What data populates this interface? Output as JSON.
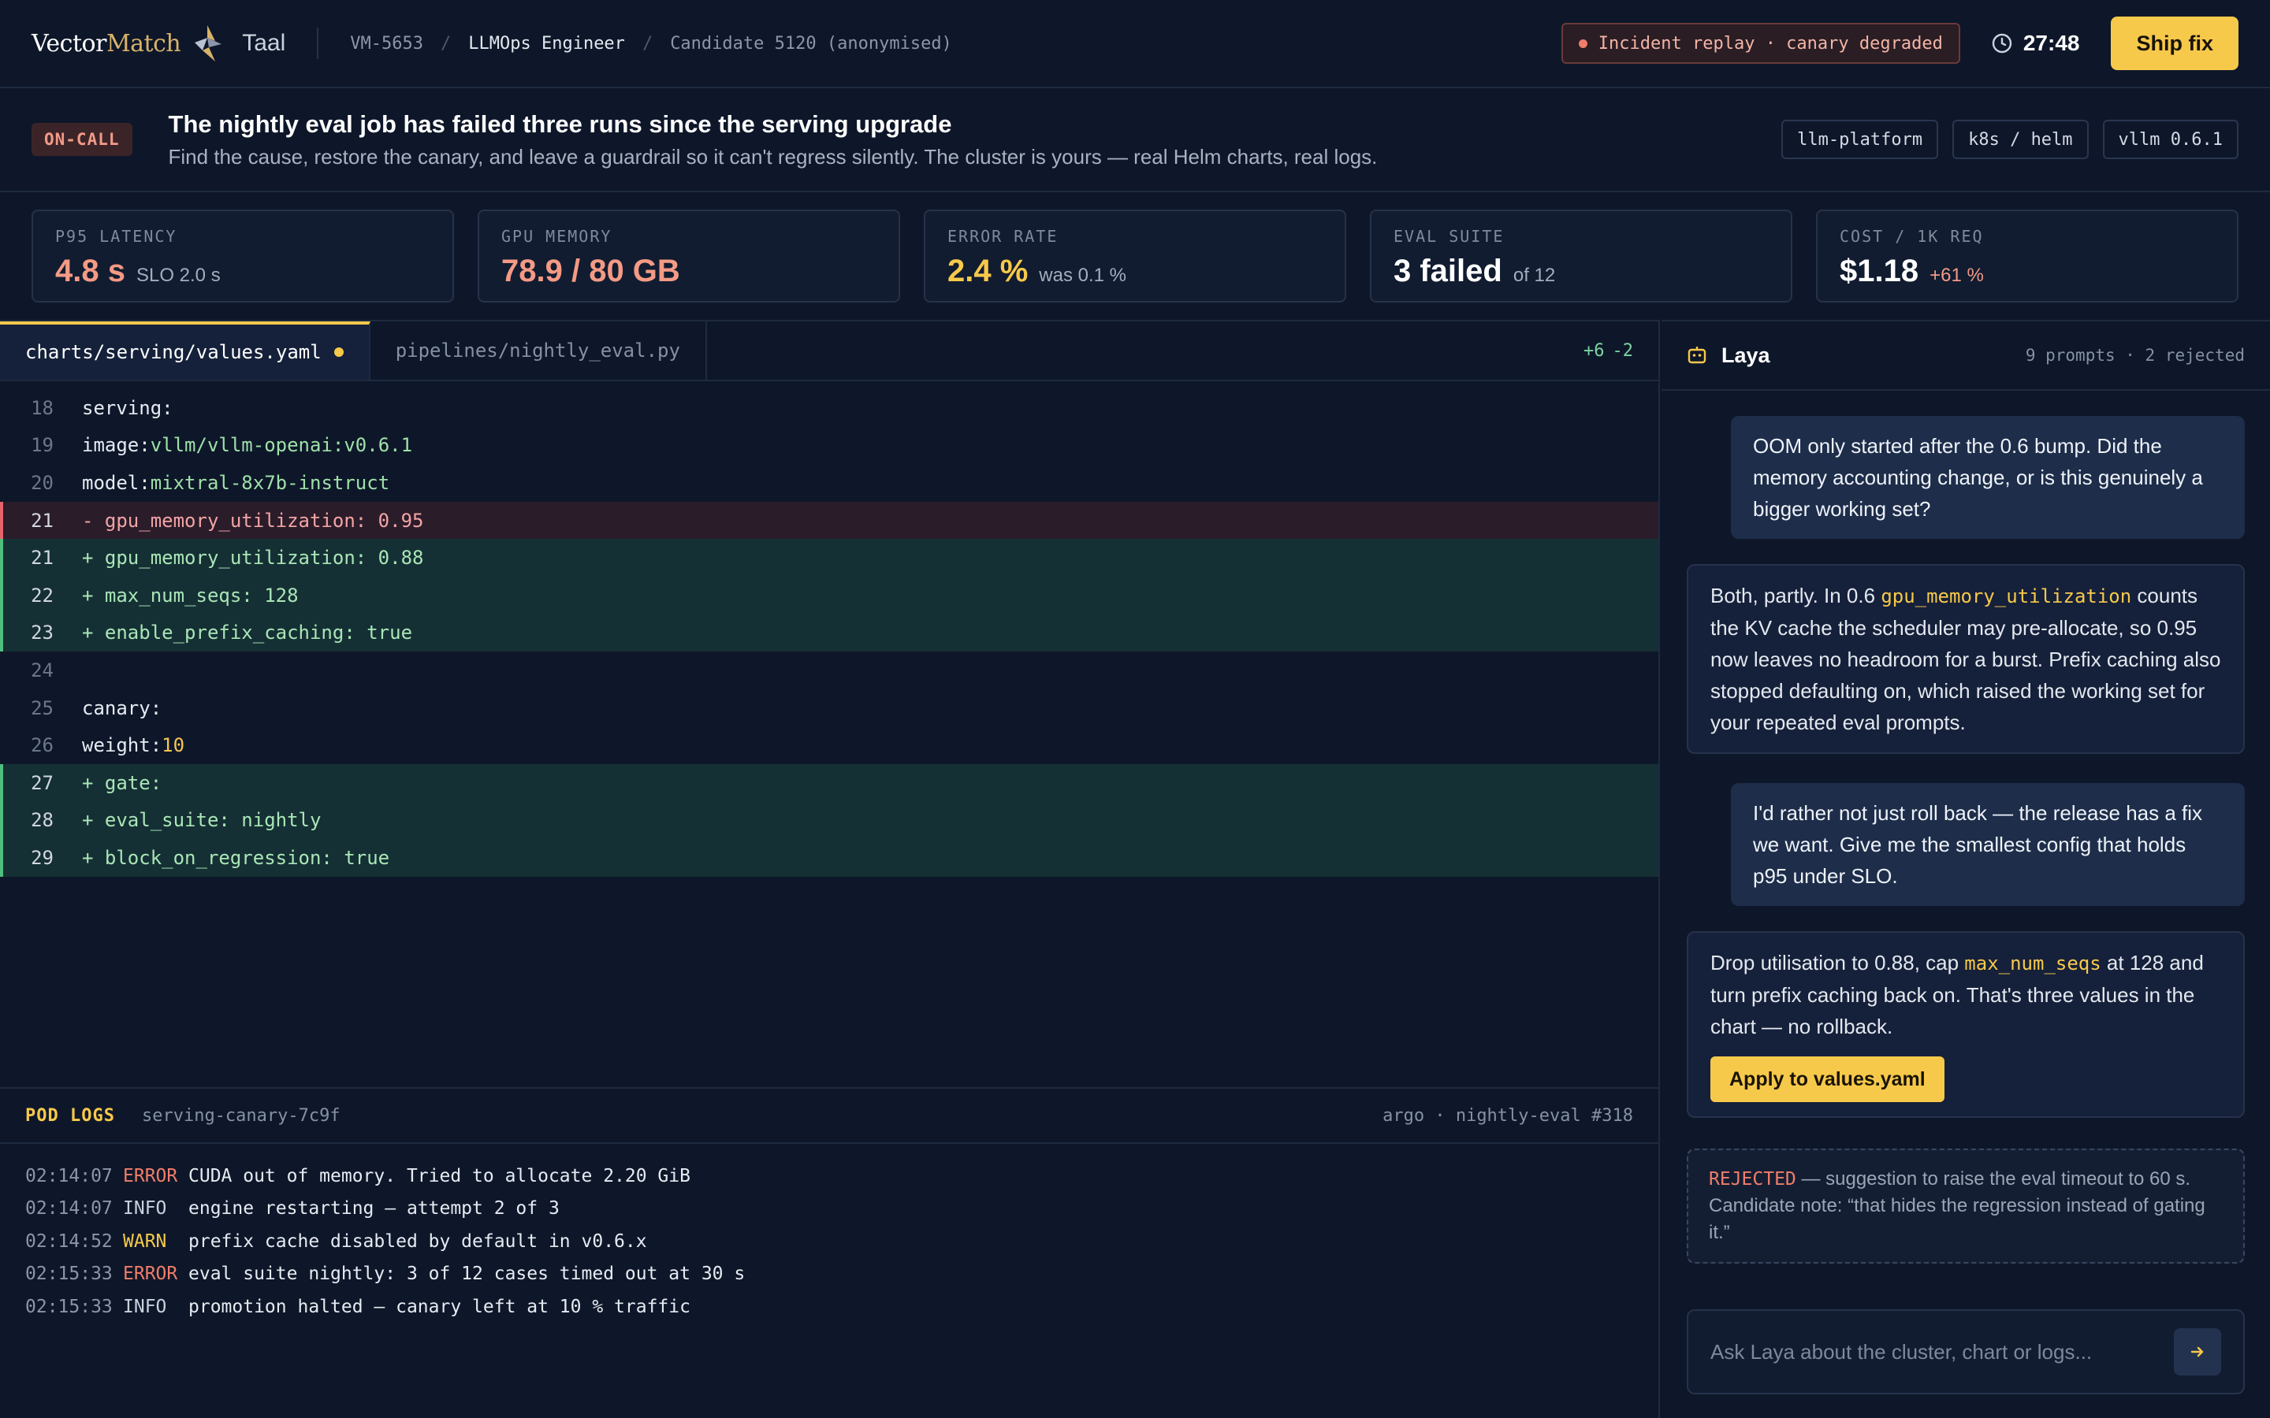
{
  "header": {
    "brand_vector": "Vector",
    "brand_match": "Match",
    "brand_sub": "Taal",
    "breadcrumb": [
      "VM-5653",
      "LLMOps Engineer",
      "Candidate 5120 (anonymised)"
    ],
    "incident": "Incident replay · canary degraded",
    "timer": "27:48",
    "ship_label": "Ship fix"
  },
  "brief": {
    "badge": "ON-CALL",
    "title": "The nightly eval job has failed three runs since the serving upgrade",
    "subtitle": "Find the cause, restore the canary, and leave a guardrail so it can't regress silently. The cluster is yours — real Helm charts, real logs.",
    "tags": [
      "llm-platform",
      "k8s / helm",
      "vllm 0.6.1"
    ]
  },
  "metrics": [
    {
      "label": "P95 LATENCY",
      "value": "4.8 s",
      "note": "SLO 2.0 s",
      "color": "#f49a85"
    },
    {
      "label": "GPU MEMORY",
      "value": "78.9 / 80 GB",
      "note": "",
      "color": "#f49a85"
    },
    {
      "label": "ERROR RATE",
      "value": "2.4 %",
      "note": "was 0.1 %",
      "color": "#f7c94b"
    },
    {
      "label": "EVAL SUITE",
      "value": "3 failed",
      "note": "of 12",
      "color": "#ffffff"
    },
    {
      "label": "COST / 1K REQ",
      "value": "$1.18",
      "note": "+61 %",
      "color": "#ffffff",
      "note_color": "#f49a85"
    }
  ],
  "editor": {
    "tabs": [
      {
        "name": "charts/serving/values.yaml",
        "active": true,
        "modified": true
      },
      {
        "name": "pipelines/nightly_eval.py",
        "active": false,
        "modified": false
      }
    ],
    "added": "+6",
    "removed": "-2",
    "lines": [
      {
        "n": "18",
        "type": "ctx",
        "key": "serving:",
        "val": ""
      },
      {
        "n": "19",
        "type": "ctx",
        "key": "image: ",
        "val": "vllm/vllm-openai:v0.6.1",
        "vtype": "str"
      },
      {
        "n": "20",
        "type": "ctx",
        "key": "model: ",
        "val": "mixtral-8x7b-instruct",
        "vtype": "str"
      },
      {
        "n": "21",
        "type": "rem",
        "key": "- gpu_memory_utilization: 0.95",
        "val": ""
      },
      {
        "n": "21",
        "type": "add",
        "key": "+ gpu_memory_utilization: 0.88",
        "val": ""
      },
      {
        "n": "22",
        "type": "add",
        "key": "+ max_num_seqs: 128",
        "val": ""
      },
      {
        "n": "23",
        "type": "add",
        "key": "+ enable_prefix_caching: true",
        "val": ""
      },
      {
        "n": "24",
        "type": "ctx",
        "key": "",
        "val": ""
      },
      {
        "n": "25",
        "type": "ctx",
        "key": "canary:",
        "val": ""
      },
      {
        "n": "26",
        "type": "ctx",
        "key": "weight: ",
        "val": "10",
        "vtype": "num"
      },
      {
        "n": "27",
        "type": "add",
        "key": "+ gate:",
        "val": ""
      },
      {
        "n": "28",
        "type": "add",
        "key": "+ eval_suite: nightly",
        "val": ""
      },
      {
        "n": "29",
        "type": "add",
        "key": "+ block_on_regression: true",
        "val": ""
      }
    ]
  },
  "logs": {
    "title": "POD LOGS",
    "pod": "serving-canary-7c9f",
    "run": "argo · nightly-eval #318",
    "entries": [
      {
        "time": "02:14:07",
        "level": "ERROR",
        "msg": "CUDA out of memory. Tried to allocate 2.20 GiB"
      },
      {
        "time": "02:14:07",
        "level": "INFO",
        "msg": "engine restarting — attempt 2 of 3"
      },
      {
        "time": "02:14:52",
        "level": "WARN",
        "msg": "prefix cache disabled by default in v0.6.x"
      },
      {
        "time": "02:15:33",
        "level": "ERROR",
        "msg": "eval suite nightly: 3 of 12 cases timed out at 30 s"
      },
      {
        "time": "02:15:33",
        "level": "INFO",
        "msg": "promotion halted — canary left at 10 % traffic"
      }
    ]
  },
  "assistant": {
    "name": "Laya",
    "stats": "9 prompts · 2 rejected",
    "msg1": "OOM only started after the 0.6 bump. Did the memory accounting change, or is this genuinely a bigger working set?",
    "msg2_a": "Both, partly. In 0.6 ",
    "msg2_code": "gpu_memory_utilization",
    "msg2_b": " counts the KV cache the scheduler may pre-allocate, so 0.95 now leaves no headroom for a burst. Prefix caching also stopped defaulting on, which raised the working set for your repeated eval prompts.",
    "msg3": "I'd rather not just roll back — the release has a fix we want. Give me the smallest config that holds p95 under SLO.",
    "msg4_a": "Drop utilisation to 0.88, cap ",
    "msg4_code": "max_num_seqs",
    "msg4_b": " at 128 and turn prefix caching back on. That's three values in the chart — no rollback.",
    "apply_label": "Apply to values.yaml",
    "rejected_label": "REJECTED",
    "rejected_text": " — suggestion to raise the eval timeout to 60 s. Candidate note: “that hides the regression instead of gating it.”",
    "input_placeholder": "Ask Laya about the cluster, chart or logs..."
  }
}
